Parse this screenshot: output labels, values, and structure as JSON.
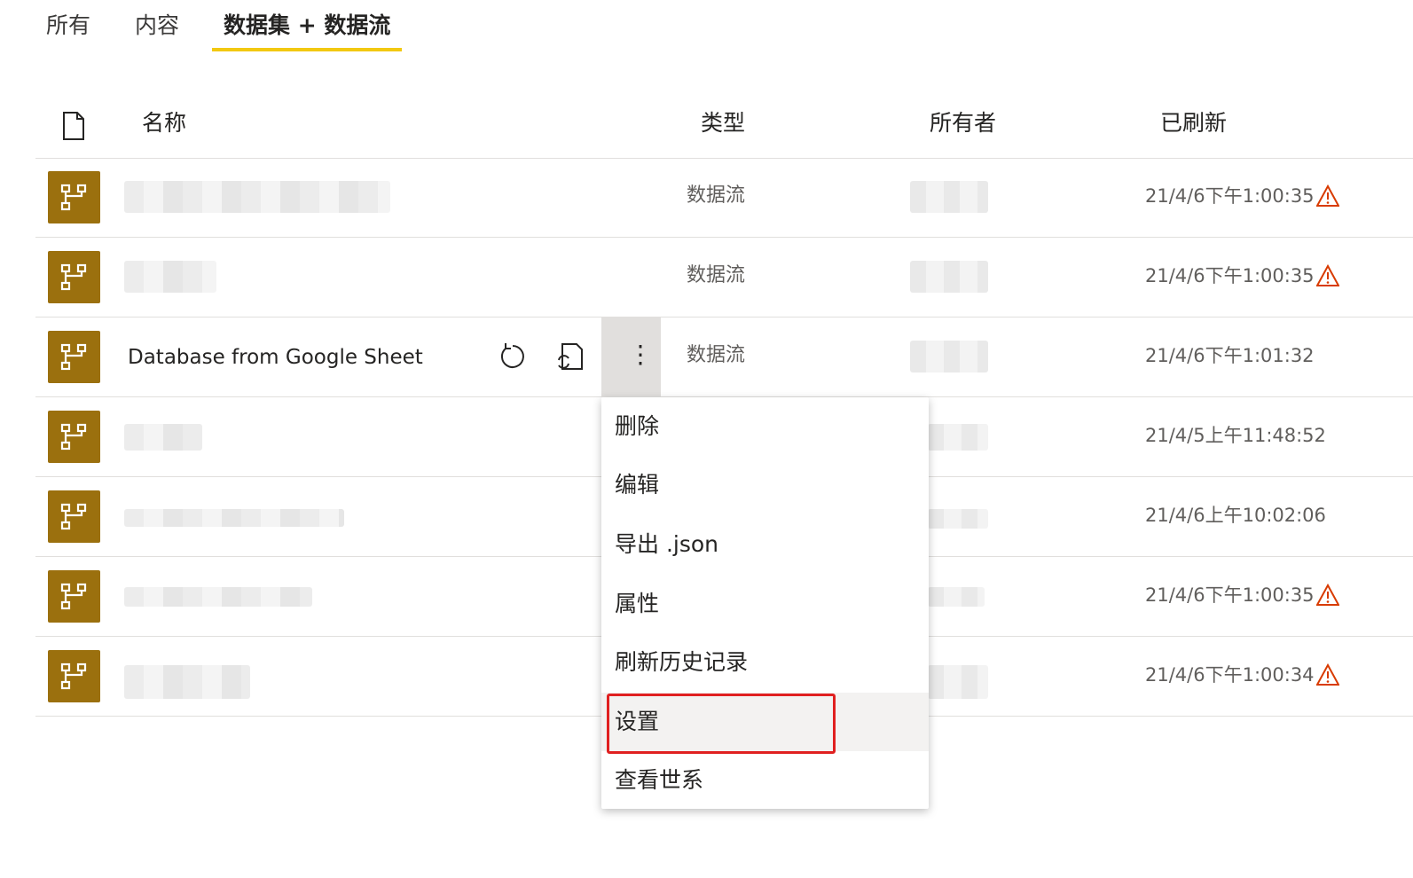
{
  "tabs": [
    {
      "label": "所有",
      "active": false
    },
    {
      "label": "内容",
      "active": false
    },
    {
      "label": "数据集 + 数据流",
      "active": true
    }
  ],
  "columns": {
    "name": "名称",
    "type": "类型",
    "owner": "所有者",
    "refreshed": "已刷新"
  },
  "rows": [
    {
      "name": "",
      "type": "数据流",
      "refreshed": "21/4/6下午1:00:35",
      "warning": true
    },
    {
      "name": "",
      "type": "数据流",
      "refreshed": "21/4/6下午1:00:35",
      "warning": true
    },
    {
      "name": "Database from Google Sheet",
      "type": "数据流",
      "refreshed": "21/4/6下午1:01:32",
      "warning": false
    },
    {
      "name": "",
      "type": "",
      "refreshed": "21/4/5上午11:48:52",
      "warning": false
    },
    {
      "name": "",
      "type": "",
      "refreshed": "21/4/6上午10:02:06",
      "warning": false
    },
    {
      "name": "",
      "type": "",
      "refreshed": "21/4/6下午1:00:35",
      "warning": true
    },
    {
      "name": "",
      "type": "",
      "refreshed": "21/4/6下午1:00:34",
      "warning": true
    }
  ],
  "row_actions": {
    "more": "⋮"
  },
  "context_menu": {
    "items": [
      {
        "label": "删除"
      },
      {
        "label": "编辑"
      },
      {
        "label": "导出 .json"
      },
      {
        "label": "属性"
      },
      {
        "label": "刷新历史记录"
      },
      {
        "label": "设置",
        "highlighted": true
      },
      {
        "label": "查看世系"
      }
    ]
  },
  "colors": {
    "accent_tab": "#f2c811",
    "dataflow_icon_bg": "#9b700e",
    "warning": "#d83b01",
    "highlight_box": "#e02020"
  }
}
